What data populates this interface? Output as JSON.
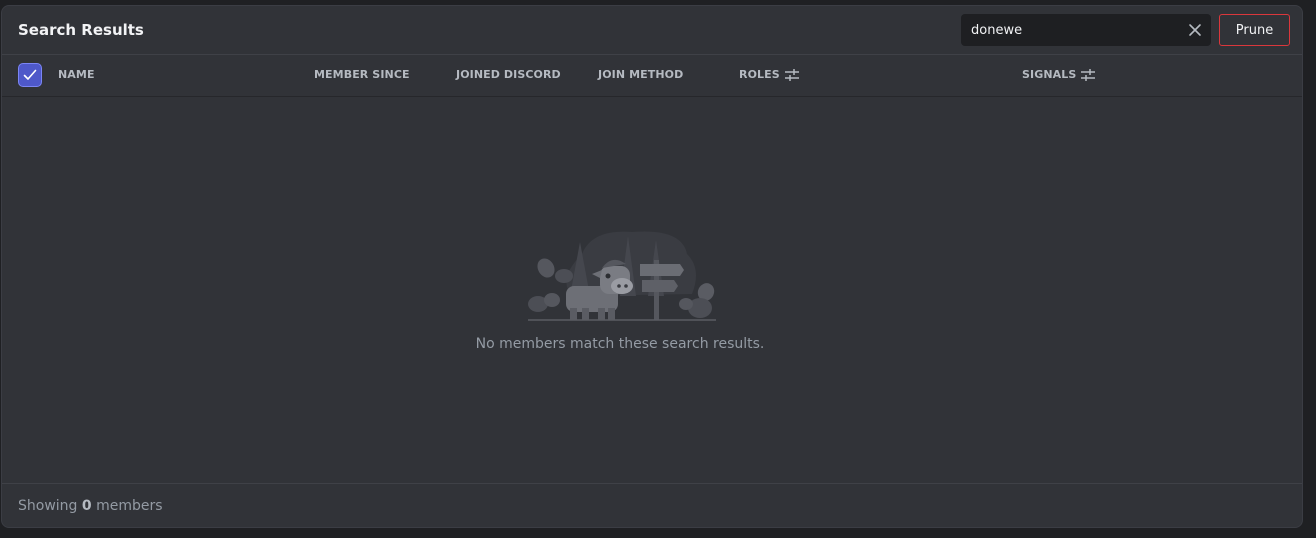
{
  "header": {
    "title": "Search Results",
    "search_value": "donewe",
    "prune_label": "Prune"
  },
  "columns": {
    "select_all_checked": true,
    "name": "NAME",
    "member_since": "MEMBER SINCE",
    "joined_discord": "JOINED DISCORD",
    "join_method": "JOIN METHOD",
    "roles": "ROLES",
    "signals": "SIGNALS"
  },
  "empty_state": {
    "message": "No members match these search results.",
    "illustration": "cow-in-forest-signpost"
  },
  "footer": {
    "prefix": "Showing",
    "count": "0",
    "suffix": "members"
  },
  "colors": {
    "panel_bg": "#313338",
    "accent": "#5865f2",
    "danger": "#da373c",
    "muted_text": "#949ba4"
  }
}
